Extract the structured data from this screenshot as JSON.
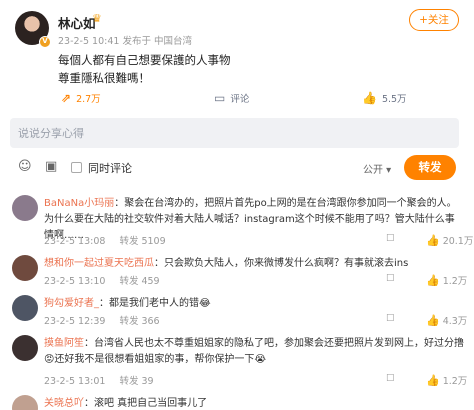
{
  "post": {
    "username": "林心如",
    "crown_icon": "crown-icon",
    "meta": {
      "date": "23-2-5 10:41",
      "source_label": "发布于",
      "location": "中国台湾"
    },
    "follow_label": "+关注",
    "lines": [
      "每個人都有自己想要保護的人事物",
      "尊重隱私很難嗎！"
    ],
    "actions": {
      "repost_count": "2.7万",
      "comment_label": "评论",
      "like_count": "5.5万"
    }
  },
  "composer": {
    "placeholder": "说说分享心得",
    "checkbox_label": "同时评论",
    "visibility_label": "公开 ▾",
    "submit_label": "转发"
  },
  "comments": [
    {
      "user": "BaNaNa小玛丽",
      "text": "聚会在台湾办的，把照片首先po上网的是在台湾跟你参加同一个聚会的人。为什么要在大陆的社交软件对着大陆人喊话？instagram这个时候不能用了吗？管大陆什么事情啊……",
      "date": "23-2-5 13:08",
      "repost": "转发 5109",
      "like": "20.1万",
      "avatar_color": "#8a7a8c"
    },
    {
      "user": "想和你一起过夏天吃西瓜",
      "text": "只会欺负大陆人，你来微博发什么疯啊？有事就滚去ins",
      "date": "23-2-5 13:10",
      "repost": "转发 459",
      "like": "1.2万",
      "avatar_color": "#6f4a3e"
    },
    {
      "user": "狗勾爱好者_",
      "text": "都是我们老中人的错😂",
      "date": "23-2-5 12:39",
      "repost": "转发 366",
      "like": "4.3万",
      "avatar_color": "#4e5564"
    },
    {
      "user": "摸鱼阿笙",
      "text": "台湾省人民也太不尊重姐姐家的隐私了吧，参加聚会还要把照片发到网上，好过分撸😡还好我不是很想看姐姐家的事，帮你保护一下😭",
      "date": "23-2-5 13:01",
      "repost": "转发 39",
      "like": "1.2万",
      "avatar_color": "#3b3030"
    },
    {
      "user": "关晓总吖",
      "text": "滚吧 真把自己当回事儿了",
      "date": "",
      "repost": "",
      "like": "",
      "avatar_color": "#c0a090"
    }
  ],
  "comment_sep": "：",
  "delete_label": "☐"
}
